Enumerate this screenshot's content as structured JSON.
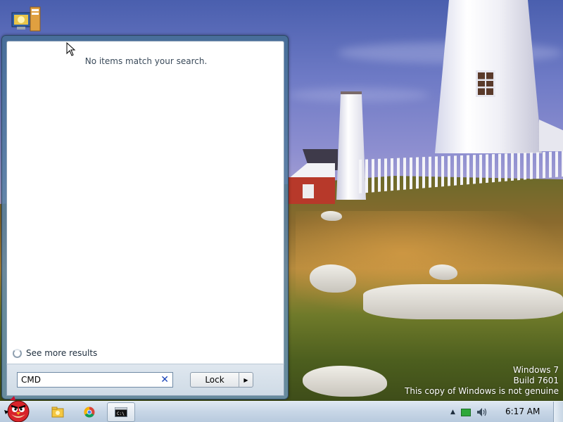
{
  "start_menu": {
    "no_items_message": "No items match your search.",
    "see_more_label": "See more results",
    "search": {
      "value": "CMD"
    },
    "power_button_label": "Lock"
  },
  "watermark": {
    "line1": "Windows 7",
    "line2": "Build 7601",
    "line3": "This copy of Windows is not genuine"
  },
  "taskbar": {
    "start_icon": "angry-bird-start-orb",
    "pinned": [
      {
        "icon": "explorer-folder-icon"
      },
      {
        "icon": "chrome-icon"
      },
      {
        "icon": "cmd-icon",
        "active": true
      }
    ],
    "tray": {
      "clock": "6:17 AM"
    }
  },
  "desktop": {
    "icons": [
      {
        "icon": "computer-network-icon"
      }
    ]
  },
  "colors": {
    "menu_frame": "#466e96",
    "taskbar": "#c7d6e6",
    "search_clear": "#1a44b8"
  }
}
